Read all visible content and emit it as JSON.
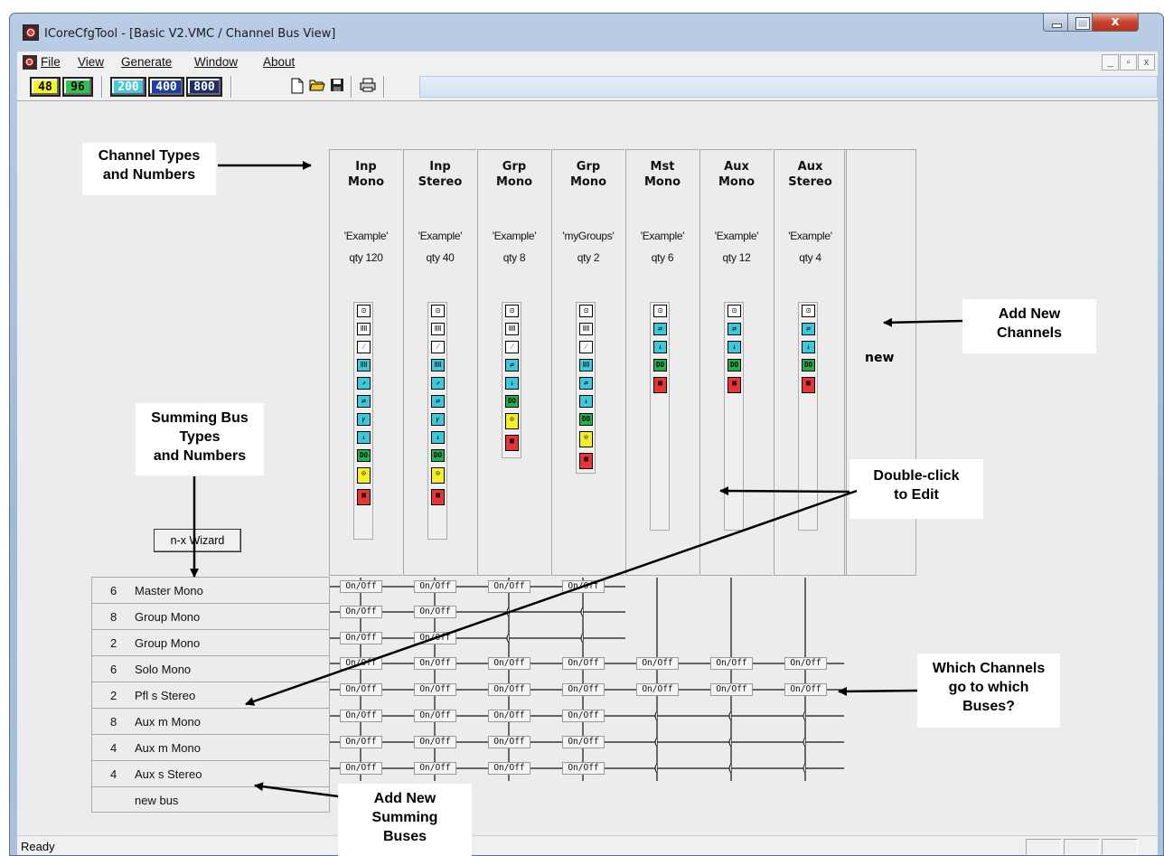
{
  "window": {
    "title": "ICoreCfgTool - [Basic V2.VMC / Channel Bus View]",
    "close_label": "x"
  },
  "menu": {
    "items": [
      {
        "label": "File"
      },
      {
        "label": "View"
      },
      {
        "label": "Generate"
      },
      {
        "label": "Window"
      },
      {
        "label": "About"
      }
    ],
    "mdi_buttons": [
      "_",
      "▫",
      "x"
    ]
  },
  "toolbar": {
    "rates": [
      {
        "label": "48",
        "bg": "#f5f523",
        "fg": "#000"
      },
      {
        "label": "96",
        "bg": "#2fc54c",
        "fg": "#000"
      },
      {
        "label": "200",
        "bg": "#45c8de",
        "fg": "#fff"
      },
      {
        "label": "400",
        "bg": "#1d3fa0",
        "fg": "#fff"
      },
      {
        "label": "800",
        "bg": "#1d2f6b",
        "fg": "#fff"
      }
    ],
    "file_icons": [
      "new-file-icon",
      "open-folder-icon",
      "save-icon",
      "print-icon"
    ]
  },
  "channels": [
    {
      "type_line1": "Inp",
      "type_line2": "Mono",
      "name": "'Example'",
      "qty": "qty 120"
    },
    {
      "type_line1": "Inp",
      "type_line2": "Stereo",
      "name": "'Example'",
      "qty": "qty 40"
    },
    {
      "type_line1": "Grp",
      "type_line2": "Mono",
      "name": "'Example'",
      "qty": "qty 8"
    },
    {
      "type_line1": "Grp",
      "type_line2": "Mono",
      "name": "'myGroups'",
      "qty": "qty 2"
    },
    {
      "type_line1": "Mst",
      "type_line2": "Mono",
      "name": "'Example'",
      "qty": "qty 6"
    },
    {
      "type_line1": "Aux",
      "type_line2": "Mono",
      "name": "'Example'",
      "qty": "qty 12"
    },
    {
      "type_line1": "Aux",
      "type_line2": "Stereo",
      "name": "'Example'",
      "qty": "qty 4"
    }
  ],
  "new_channel_label": "new",
  "wizard_label": "n-x Wizard",
  "buses": [
    {
      "qty": "6",
      "name": "Master Mono"
    },
    {
      "qty": "8",
      "name": "Group Mono"
    },
    {
      "qty": "2",
      "name": "Group Mono"
    },
    {
      "qty": "6",
      "name": "Solo Mono"
    },
    {
      "qty": "2",
      "name": "Pfl s Stereo"
    },
    {
      "qty": "8",
      "name": "Aux m Mono"
    },
    {
      "qty": "4",
      "name": "Aux m Mono"
    },
    {
      "qty": "4",
      "name": "Aux s Stereo"
    }
  ],
  "new_bus_label": "new bus",
  "onoff_label": "On/Off",
  "callouts": {
    "channel_types_1": "Channel Types",
    "channel_types_2": "and Numbers",
    "summing_1": "Summing Bus",
    "summing_2": "Types",
    "summing_3": "and Numbers",
    "add_channels_1": "Add New",
    "add_channels_2": "Channels",
    "double_click_1": "Double-click",
    "double_click_2": "to Edit",
    "which_1": "Which Channels",
    "which_2": "go to which",
    "which_3": "Buses?",
    "add_buses_1": "Add New",
    "add_buses_2": "Summing",
    "add_buses_3": "Buses"
  },
  "status": {
    "text": "Ready"
  }
}
